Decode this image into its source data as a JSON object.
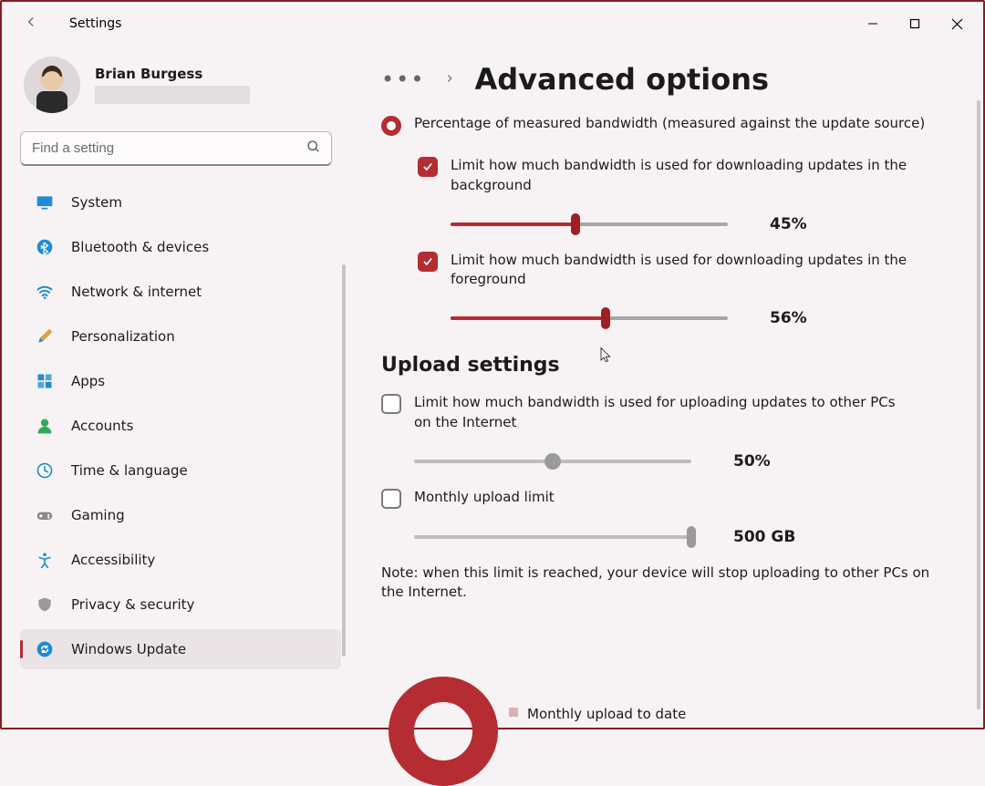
{
  "app_title": "Settings",
  "user": {
    "name": "Brian Burgess"
  },
  "search": {
    "placeholder": "Find a setting"
  },
  "nav": [
    {
      "id": "system",
      "label": "System"
    },
    {
      "id": "bluetooth",
      "label": "Bluetooth & devices"
    },
    {
      "id": "network",
      "label": "Network & internet"
    },
    {
      "id": "personalization",
      "label": "Personalization"
    },
    {
      "id": "apps",
      "label": "Apps"
    },
    {
      "id": "accounts",
      "label": "Accounts"
    },
    {
      "id": "time",
      "label": "Time & language"
    },
    {
      "id": "gaming",
      "label": "Gaming"
    },
    {
      "id": "accessibility",
      "label": "Accessibility"
    },
    {
      "id": "privacy",
      "label": "Privacy & security"
    },
    {
      "id": "update",
      "label": "Windows Update"
    }
  ],
  "active_nav": "update",
  "breadcrumb": {
    "title": "Advanced options"
  },
  "radio": {
    "label": "Percentage of measured bandwidth (measured against the update source)"
  },
  "download": {
    "bg": {
      "label": "Limit how much bandwidth is used for downloading updates in the background",
      "checked": true,
      "value": 45,
      "display": "45%"
    },
    "fg": {
      "label": "Limit how much bandwidth is used for downloading updates in the foreground",
      "checked": true,
      "value": 56,
      "display": "56%"
    }
  },
  "upload_heading": "Upload settings",
  "upload": {
    "limit": {
      "label": "Limit how much bandwidth is used for uploading updates to other PCs on the Internet",
      "checked": false,
      "value": 50,
      "display": "50%"
    },
    "monthly": {
      "label": "Monthly upload limit",
      "checked": false,
      "value": 100,
      "display": "500 GB"
    }
  },
  "note": "Note: when this limit is reached, your device will stop uploading to other PCs on the Internet.",
  "monthly_stats_label": "Monthly upload to date"
}
